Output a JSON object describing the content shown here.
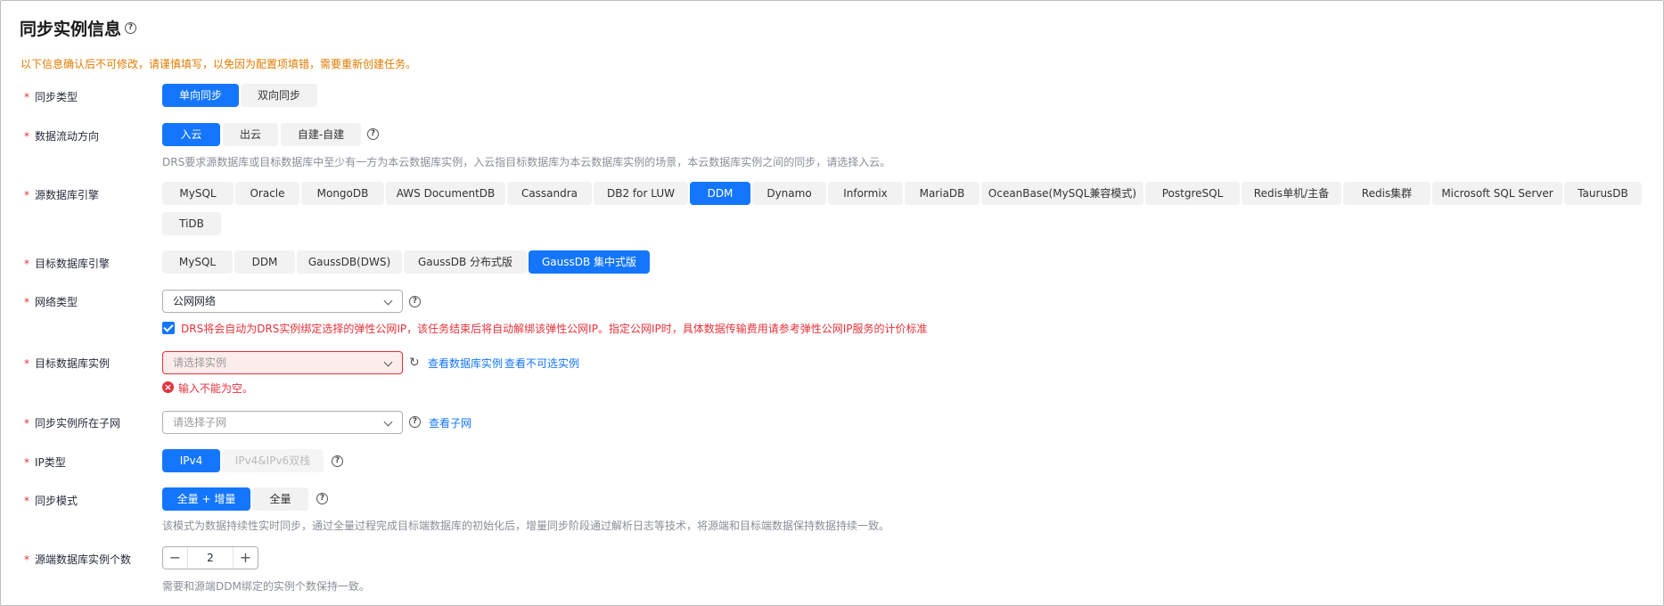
{
  "title": "同步实例信息",
  "notice": "以下信息确认后不可修改，请谨慎填写，以免因为配置项填错，需要重新创建任务。",
  "labels": {
    "sync_type": "同步类型",
    "data_flow": "数据流动方向",
    "source_engine": "源数据库引擎",
    "target_engine": "目标数据库引擎",
    "network_type": "网络类型",
    "target_instance": "目标数据库实例",
    "subnet": "同步实例所在子网",
    "ip_type": "IP类型",
    "sync_mode": "同步模式",
    "source_count": "源端数据库实例个数"
  },
  "sync_type": {
    "options": [
      "单向同步",
      "双向同步"
    ],
    "selected": "单向同步"
  },
  "data_flow": {
    "options": [
      "入云",
      "出云",
      "自建-自建"
    ],
    "selected": "入云",
    "hint": "DRS要求源数据库或目标数据库中至少有一方为本云数据库实例，入云指目标数据库为本云数据库实例的场景，本云数据库实例之间的同步，请选择入云。"
  },
  "source_engine": {
    "options": [
      "MySQL",
      "Oracle",
      "MongoDB",
      "AWS DocumentDB",
      "Cassandra",
      "DB2 for LUW",
      "DDM",
      "Dynamo",
      "Informix",
      "MariaDB",
      "OceanBase(MySQL兼容模式)",
      "PostgreSQL",
      "Redis单机/主备",
      "Redis集群",
      "Microsoft SQL Server",
      "TaurusDB",
      "TiDB"
    ],
    "selected": "DDM"
  },
  "target_engine": {
    "options": [
      "MySQL",
      "DDM",
      "GaussDB(DWS)",
      "GaussDB 分布式版",
      "GaussDB 集中式版"
    ],
    "selected": "GaussDB 集中式版"
  },
  "network": {
    "value": "公网网络",
    "eip_notice": "DRS将会自动为DRS实例绑定选择的弹性公网IP，该任务结束后将自动解绑该弹性公网IP。指定公网IP时，具体数据传输费用请参考弹性公网IP服务的计价标准",
    "eip_checked": true
  },
  "target_instance": {
    "placeholder": "请选择实例",
    "link_view": "查看数据库实例",
    "link_unavailable": "查看不可选实例",
    "error": "输入不能为空。"
  },
  "subnet": {
    "placeholder": "请选择子网",
    "link_view": "查看子网"
  },
  "ip_type": {
    "options": [
      "IPv4",
      "IPv4&IPv6双栈"
    ],
    "selected": "IPv4",
    "disabled": "IPv4&IPv6双栈"
  },
  "sync_mode": {
    "options": [
      "全量 + 增量",
      "全量"
    ],
    "selected": "全量 + 增量",
    "hint": "该模式为数据持续性实时同步，通过全量过程完成目标端数据库的初始化后，增量同步阶段通过解析日志等技术，将源端和目标端数据保持数据持续一致。"
  },
  "source_count": {
    "value": "2",
    "hint": "需要和源端DDM绑定的实例个数保持一致。"
  },
  "icons": {
    "help": "help-circle-icon",
    "chevron": "chevron-down-icon",
    "refresh": "refresh-icon",
    "error": "error-circle-icon",
    "check": "check-icon",
    "minus": "minus-icon",
    "plus": "plus-icon"
  },
  "colors": {
    "accent": "#1476ff",
    "error": "#e5323a",
    "notice": "#e07b00"
  }
}
